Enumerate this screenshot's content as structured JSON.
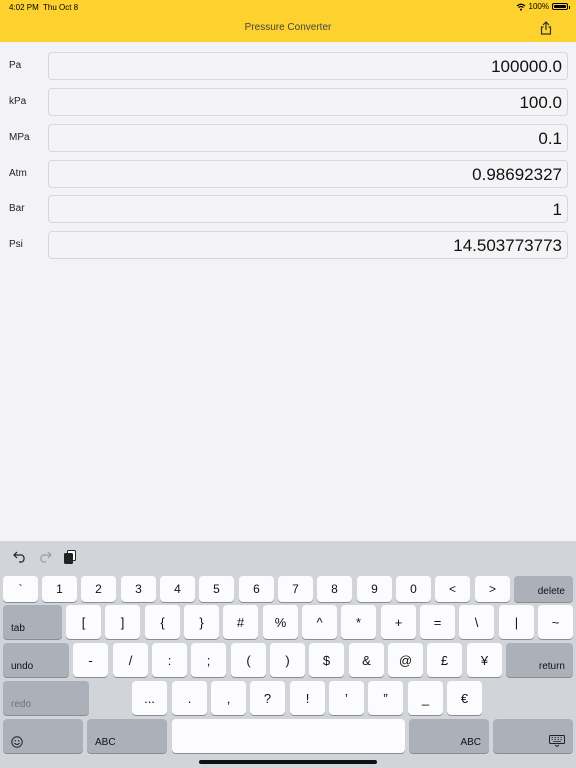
{
  "status": {
    "time": "4:02 PM",
    "date": "Thu Oct 8",
    "battery": "100%"
  },
  "nav": {
    "title": "Pressure Converter",
    "share_icon": "share-icon"
  },
  "rows": [
    {
      "label": "Pa",
      "value": "100000.0"
    },
    {
      "label": "kPa",
      "value": "100.0"
    },
    {
      "label": "MPa",
      "value": "0.1"
    },
    {
      "label": "Atm",
      "value": "0.98692327"
    },
    {
      "label": "Bar",
      "value": "1"
    },
    {
      "label": "Psi",
      "value": "14.503773773"
    }
  ],
  "keyboard": {
    "row1": [
      "`",
      "1",
      "2",
      "3",
      "4",
      "5",
      "6",
      "7",
      "8",
      "9",
      "0",
      "<",
      ">"
    ],
    "delete": "delete",
    "tab": "tab",
    "row2": [
      "[",
      "]",
      "{",
      "}",
      "#",
      "%",
      "^",
      "*",
      "+",
      "=",
      "\\",
      "|",
      "~"
    ],
    "undo": "undo",
    "row3": [
      "-",
      "/",
      ":",
      ";",
      "(",
      ")",
      "$",
      "&",
      "@",
      "£",
      "¥"
    ],
    "return": "return",
    "redo": "redo",
    "row4": [
      "...",
      ".",
      ",",
      "?",
      "!",
      "’",
      "”",
      "_",
      "€"
    ],
    "abc_left": "ABC",
    "abc_right": "ABC"
  }
}
